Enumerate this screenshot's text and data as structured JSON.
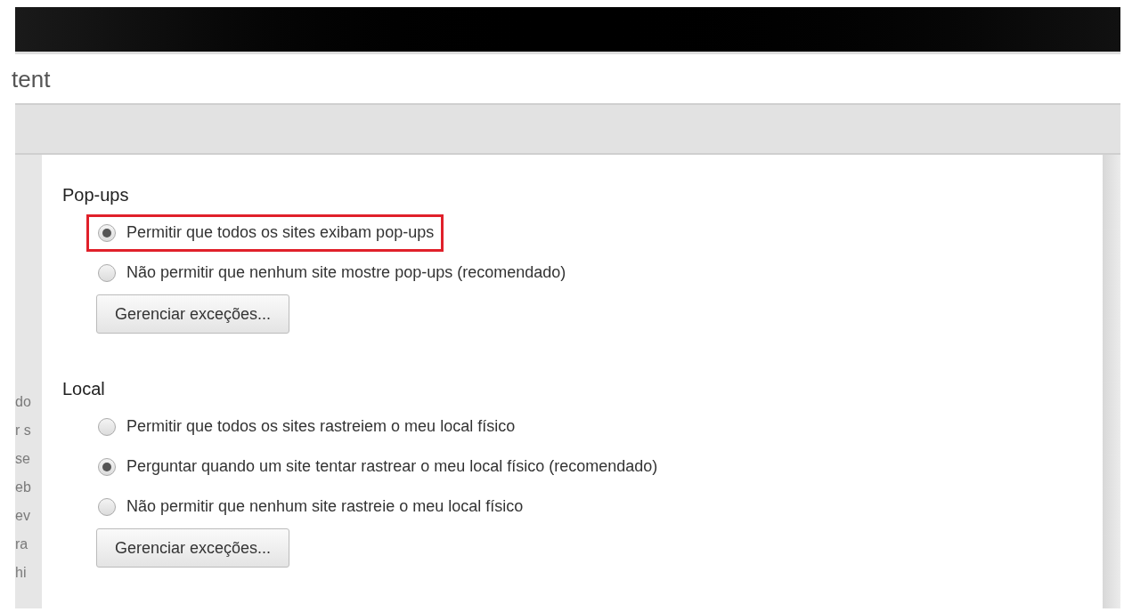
{
  "window": {
    "title": "tent"
  },
  "background_fragments": [
    "do",
    "r s",
    "se",
    "eb",
    "ev",
    "ra",
    "hi"
  ],
  "sections": [
    {
      "heading": "Pop-ups",
      "options": [
        {
          "label": "Permitir que todos os sites exibam pop-ups",
          "selected": true,
          "highlighted": true
        },
        {
          "label": "Não permitir que nenhum site mostre pop-ups (recomendado)",
          "selected": false,
          "highlighted": false
        }
      ],
      "button": "Gerenciar exceções..."
    },
    {
      "heading": "Local",
      "options": [
        {
          "label": "Permitir que todos os sites rastreiem o meu local físico",
          "selected": false,
          "highlighted": false
        },
        {
          "label": "Perguntar quando um site tentar rastrear o meu local físico (recomendado)",
          "selected": true,
          "highlighted": false
        },
        {
          "label": "Não permitir que nenhum site rastreie o meu local físico",
          "selected": false,
          "highlighted": false
        }
      ],
      "button": "Gerenciar exceções..."
    }
  ]
}
